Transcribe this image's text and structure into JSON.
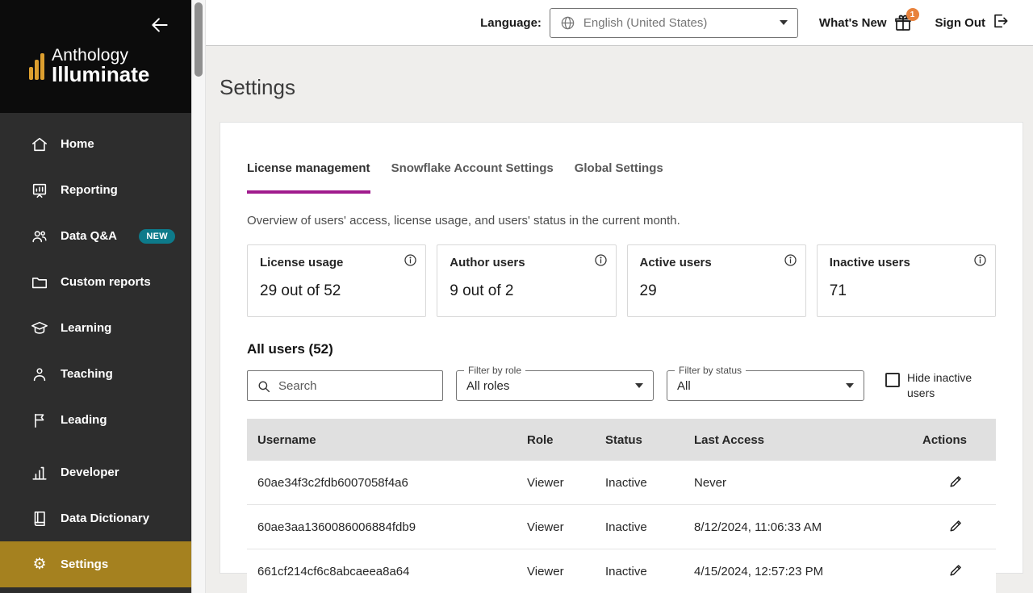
{
  "sidebar": {
    "brand_line1": "Anthology",
    "brand_line2": "Illuminate",
    "items": [
      {
        "label": "Home"
      },
      {
        "label": "Reporting"
      },
      {
        "label": "Data Q&A",
        "badge": "NEW"
      },
      {
        "label": "Custom reports"
      },
      {
        "label": "Learning"
      },
      {
        "label": "Teaching"
      },
      {
        "label": "Leading"
      },
      {
        "label": "Developer"
      },
      {
        "label": "Data Dictionary"
      },
      {
        "label": "Settings"
      }
    ]
  },
  "topbar": {
    "language_label": "Language:",
    "language_value": "English (United States)",
    "whats_new_label": "What's New",
    "whats_new_badge": "1",
    "sign_out_label": "Sign Out"
  },
  "page": {
    "title": "Settings",
    "tabs": [
      {
        "label": "License management"
      },
      {
        "label": "Snowflake Account Settings"
      },
      {
        "label": "Global Settings"
      }
    ],
    "description": "Overview of users' access, license usage, and users' status in the current month.",
    "stats": [
      {
        "label": "License usage",
        "value": "29 out of 52"
      },
      {
        "label": "Author users",
        "value": "9 out of 2"
      },
      {
        "label": "Active users",
        "value": "29"
      },
      {
        "label": "Inactive users",
        "value": "71"
      }
    ],
    "all_users_heading": "All users (52)",
    "search_placeholder": "Search",
    "filter_role_label": "Filter by role",
    "filter_role_value": "All roles",
    "filter_status_label": "Filter by status",
    "filter_status_value": "All",
    "hide_inactive_label": "Hide inactive users",
    "table": {
      "headers": [
        "Username",
        "Role",
        "Status",
        "Last Access",
        "Actions"
      ],
      "rows": [
        {
          "username": "60ae34f3c2fdb6007058f4a6",
          "role": "Viewer",
          "status": "Inactive",
          "last_access": "Never"
        },
        {
          "username": "60ae3aa1360086006884fdb9",
          "role": "Viewer",
          "status": "Inactive",
          "last_access": "8/12/2024, 11:06:33 AM"
        },
        {
          "username": "661cf214cf6c8abcaeea8a64",
          "role": "Viewer",
          "status": "Inactive",
          "last_access": "4/15/2024, 12:57:23 PM"
        }
      ]
    }
  },
  "colors": {
    "sidebar_active_gold": "#a5811f",
    "logo_gold": "#dd9f2f",
    "tab_underline_magenta": "#a01b8d",
    "new_badge_teal": "#0d7a8a",
    "notification_orange": "#e8823c"
  }
}
